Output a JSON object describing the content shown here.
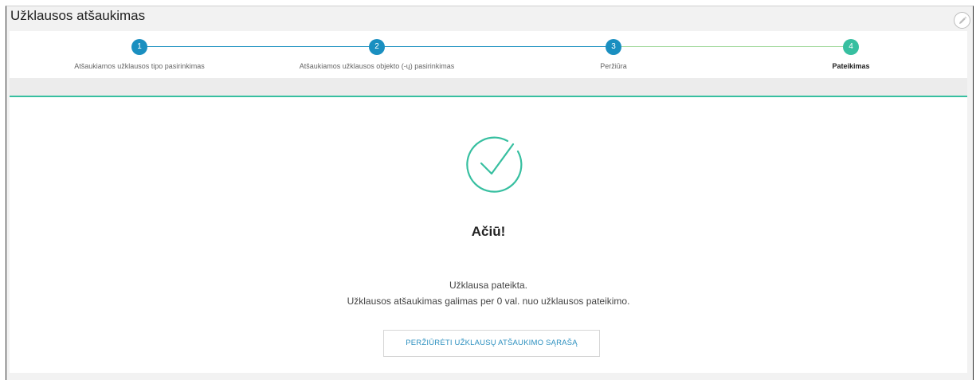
{
  "header": {
    "title": "Užklausos atšaukimas",
    "edit_icon": "pencil-icon"
  },
  "stepper": {
    "steps": [
      {
        "number": "1",
        "label": "Atšaukiamos užklausos tipo pasirinkimas",
        "state": "done"
      },
      {
        "number": "2",
        "label": "Atšaukiamos užklausos objekto (-ų) pasirinkimas",
        "state": "done"
      },
      {
        "number": "3",
        "label": "Peržiūra",
        "state": "done"
      },
      {
        "number": "4",
        "label": "Pateikimas",
        "state": "active"
      }
    ],
    "colors": {
      "done": "#1a8fc0",
      "active": "#37bfa0",
      "line_done": "#1a8fc0",
      "line_active": "#9fd89a"
    }
  },
  "success": {
    "icon": "check-circle-icon",
    "icon_color": "#37bfa0",
    "heading": "Ačiū!",
    "message_line1": "Užklausa pateikta.",
    "message_line2": "Užklausos atšaukimas galimas per 0 val. nuo užklausos pateikimo.",
    "button_label": "PERŽIŪRĖTI UŽKLAUSŲ ATŠAUKIMO SĄRAŠĄ"
  }
}
